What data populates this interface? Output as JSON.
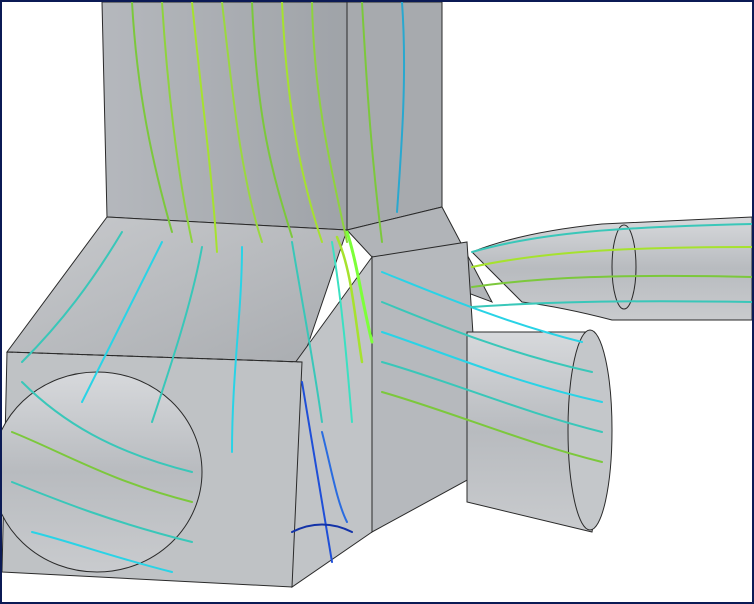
{
  "scene": {
    "subject": "duct-junction-streamlines",
    "colors": {
      "border": "#0b1a55",
      "background": "#ffffff",
      "duct_fill": "#b9bcc1",
      "duct_stroke": "#2a2a2a",
      "stream_green": "#7cc83c",
      "stream_lime": "#a6e22e",
      "stream_teal": "#39c7b9",
      "stream_cyan": "#29d3e6",
      "stream_blue": "#1f4fd8",
      "stream_navy": "#1232a8"
    }
  }
}
